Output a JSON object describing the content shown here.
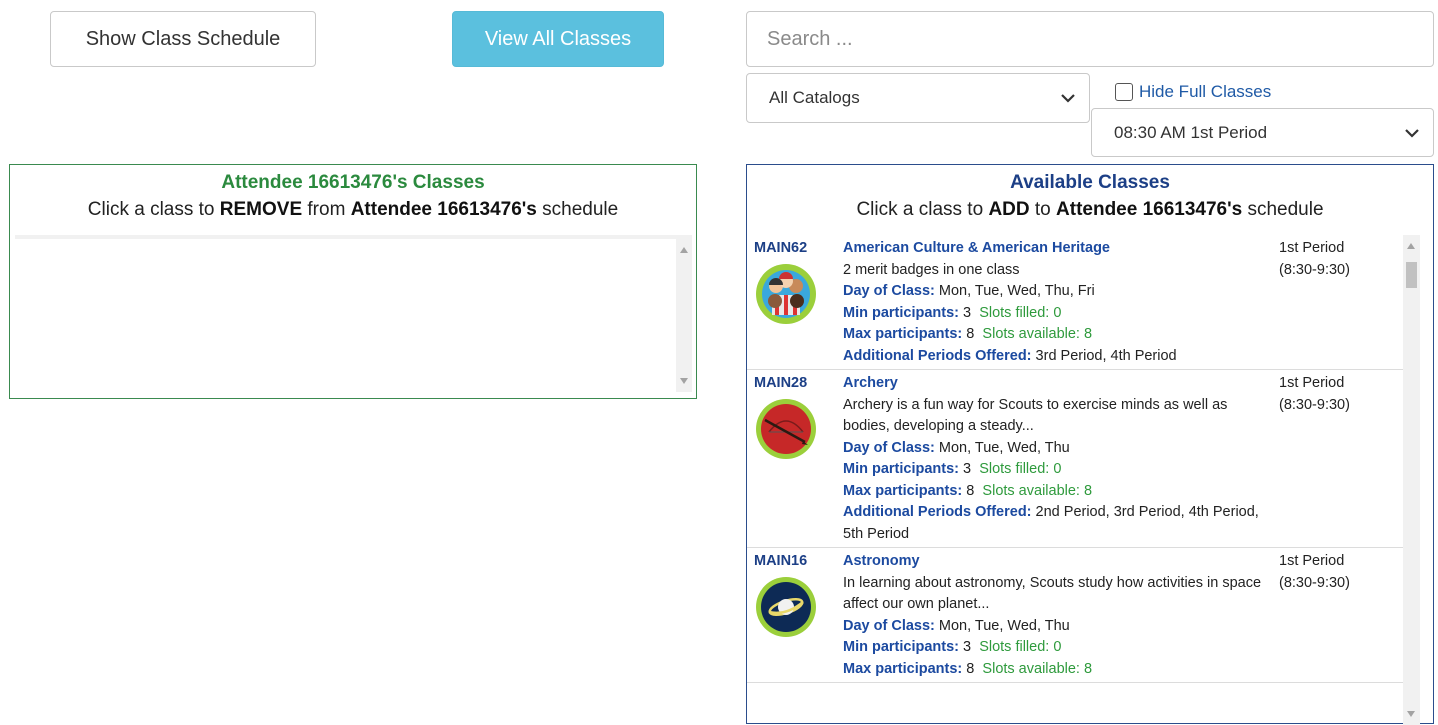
{
  "buttons": {
    "show_schedule": "Show Class Schedule",
    "view_all": "View All Classes"
  },
  "search": {
    "placeholder": "Search ..."
  },
  "filters": {
    "catalog": "All Catalogs",
    "hide_full_label": "Hide Full Classes",
    "hide_full_checked": false,
    "period": "08:30 AM 1st Period"
  },
  "left_panel": {
    "title": "Attendee 16613476's Classes",
    "sub_pre": "Click a class to ",
    "sub_action": "REMOVE",
    "sub_mid": " from ",
    "sub_name": "Attendee 16613476's",
    "sub_post": " schedule"
  },
  "right_panel": {
    "title": "Available Classes",
    "sub_pre": "Click a class to ",
    "sub_action": "ADD",
    "sub_mid": " to ",
    "sub_name": "Attendee 16613476's",
    "sub_post": " schedule",
    "labels": {
      "day": "Day of Class:",
      "min": "Min participants:",
      "max": "Max participants:",
      "filled": "Slots filled:",
      "available": "Slots available:",
      "additional": "Additional Periods Offered:"
    },
    "classes": [
      {
        "code": "MAIN62",
        "name": "American Culture & American Heritage",
        "description": "2 merit badges in one class",
        "period": "1st Period",
        "time": "(8:30-9:30)",
        "days": "Mon, Tue, Wed, Thu, Fri",
        "min": "3",
        "filled": "0",
        "max": "8",
        "available": "8",
        "additional": "3rd Period, 4th Period",
        "badge": "american-culture-badge-icon"
      },
      {
        "code": "MAIN28",
        "name": "Archery",
        "description": "Archery is a fun way for Scouts to exercise minds as well as bodies, developing a steady...",
        "period": "1st Period",
        "time": "(8:30-9:30)",
        "days": "Mon, Tue, Wed, Thu",
        "min": "3",
        "filled": "0",
        "max": "8",
        "available": "8",
        "additional": "2nd Period, 3rd Period, 4th Period, 5th Period",
        "badge": "archery-badge-icon"
      },
      {
        "code": "MAIN16",
        "name": "Astronomy",
        "description": "In learning about astronomy, Scouts study how activities in space affect our own planet...",
        "period": "1st Period",
        "time": "(8:30-9:30)",
        "days": "Mon, Tue, Wed, Thu",
        "min": "3",
        "filled": "0",
        "max": "8",
        "available": "8",
        "additional": "",
        "badge": "astronomy-badge-icon"
      }
    ]
  }
}
